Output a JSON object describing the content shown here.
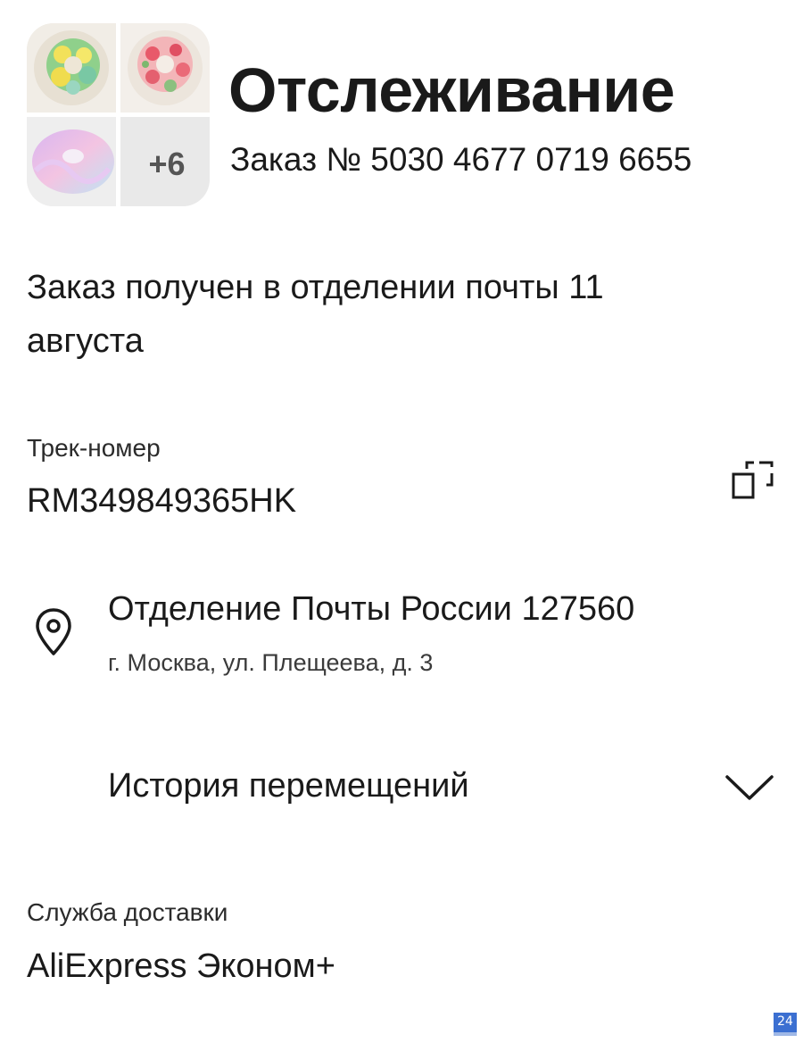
{
  "header": {
    "title": "Отслеживание",
    "order_number": "Заказ № 5030 4677 0719 6655",
    "more_items_label": "+6",
    "thumbnails": [
      "scrunchie-green-yellow",
      "scrunchie-pink-floral",
      "scrunchie-pastel-gradient"
    ]
  },
  "status": {
    "text": "Заказ получен в отделении почты 11 августа"
  },
  "tracking": {
    "label": "Трек-номер",
    "number": "RM349849365HK",
    "copy_icon": "copy-icon"
  },
  "pickup_point": {
    "icon": "location-pin-icon",
    "name": "Отделение Почты России 127560",
    "address": "г. Москва, ул. Плещеева, д. 3"
  },
  "history": {
    "label": "История перемещений",
    "icon": "chevron-down-icon"
  },
  "delivery_service": {
    "label": "Служба доставки",
    "value": "AliExpress Эконом+"
  },
  "watermark": {
    "text": "24",
    "color": "#3b6fd1"
  }
}
